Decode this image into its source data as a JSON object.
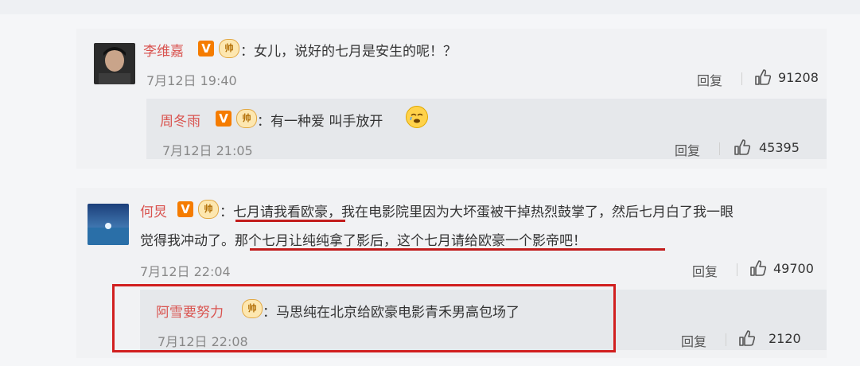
{
  "comments": [
    {
      "user": "李维嘉",
      "vip": "帅",
      "text": "：女儿，说好的七月是安生的呢！？",
      "time": "7月12日 19:40",
      "reply": "回复",
      "likes": "91208",
      "sub": {
        "user": "周冬雨",
        "vip": "帅",
        "text": "：有一种爱 叫手放开",
        "time": "7月12日 21:05",
        "reply": "回复",
        "likes": "45395"
      }
    },
    {
      "user": "何炅",
      "vip": "帅",
      "text_part1": "：",
      "text_highlight1": "七月请我看欧豪",
      "text_part2": "，我在电影院里因为大坏蛋被干掉热烈鼓掌了，然后七月白了我一眼",
      "text_line2a": "觉得我冲动了。",
      "text_highlight2": "那个七月让纯纯拿了影后，这个七月请给欧豪一个影帝吧！",
      "time": "7月12日 22:04",
      "reply": "回复",
      "likes": "49700",
      "sub": {
        "user": "阿雪要努力",
        "vip": "帅",
        "text": "：马思纯在北京给欧豪电影青禾男高包场了",
        "time": "7月12日 22:08",
        "reply": "回复",
        "likes": "2120"
      }
    }
  ],
  "badge_v": "V",
  "colors": {
    "username": "#d9534f",
    "highlight": "#c21c1c",
    "accent": "#f57c00"
  }
}
